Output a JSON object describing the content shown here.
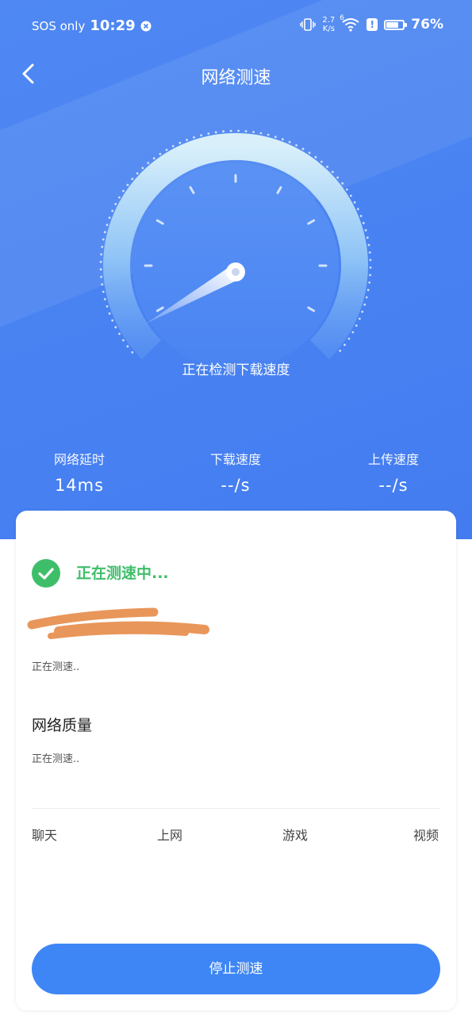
{
  "status_bar": {
    "carrier": "SOS only",
    "time": "10:29",
    "net_speed_value": "2.7",
    "net_speed_unit": "K/s",
    "wifi_badge": "6",
    "battery_text": "76%",
    "battery_level": 0.76
  },
  "header": {
    "title": "网络测速"
  },
  "gauge": {
    "status_text": "正在检测下载速度"
  },
  "stats": [
    {
      "label": "网络延时",
      "value": "14ms"
    },
    {
      "label": "下载速度",
      "value": "--/s"
    },
    {
      "label": "上传速度",
      "value": "--/s"
    }
  ],
  "card": {
    "testing_title": "正在测速中...",
    "server_status": "正在测速..",
    "quality_title": "网络质量",
    "quality_status": "正在测速..",
    "categories": [
      "聊天",
      "上网",
      "游戏",
      "视频"
    ],
    "stop_button": "停止测速"
  },
  "colors": {
    "primary": "#4a84f2",
    "success": "#3fbe6a",
    "button": "#3e86f5",
    "redaction": "#e9965a"
  }
}
